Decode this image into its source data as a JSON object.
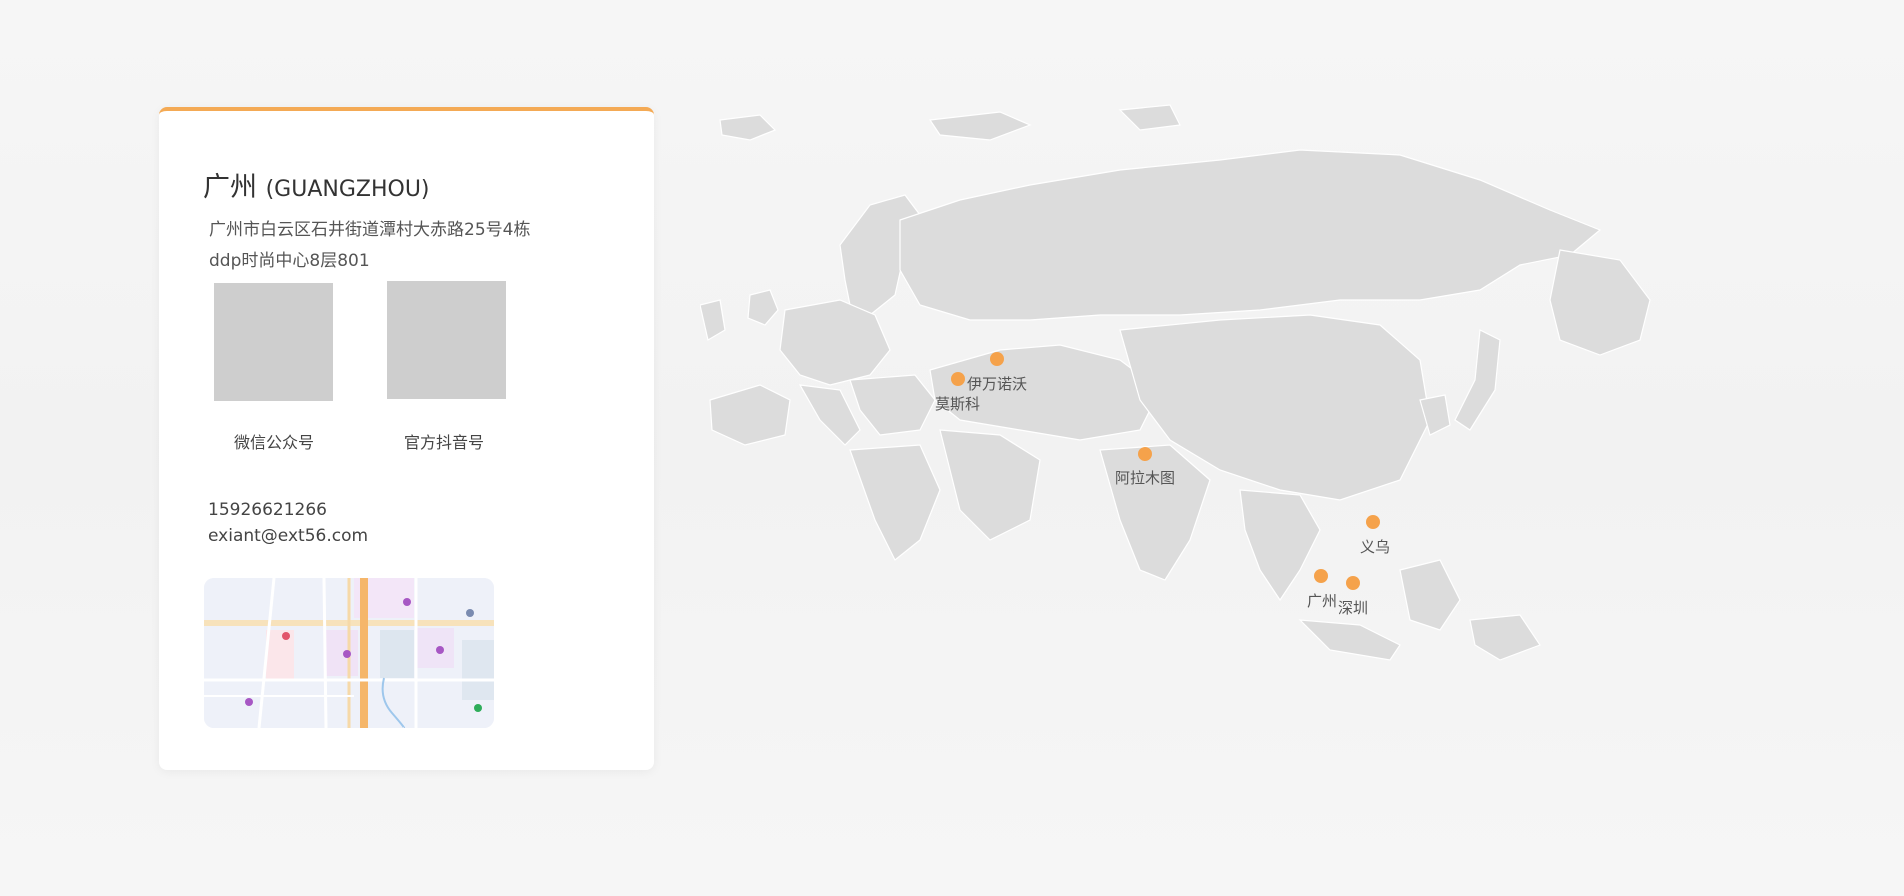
{
  "office": {
    "city_cn": "广州",
    "city_en": "(GUANGZHOU)",
    "address_line1": "广州市白云区石井街道潭村大赤路25号4栋",
    "address_line2": "ddp时尚中心8层801"
  },
  "qr_codes": [
    {
      "label": "微信公众号"
    },
    {
      "label": "官方抖音号"
    }
  ],
  "contact": {
    "phone": "15926621266",
    "email": "exiant@ext56.com"
  },
  "accent_color": "#f5a24b",
  "map_cities": [
    {
      "name": "伊万诺沃"
    },
    {
      "name": "莫斯科"
    },
    {
      "name": "阿拉木图"
    },
    {
      "name": "义乌"
    },
    {
      "name": "广州"
    },
    {
      "name": "深圳"
    }
  ]
}
